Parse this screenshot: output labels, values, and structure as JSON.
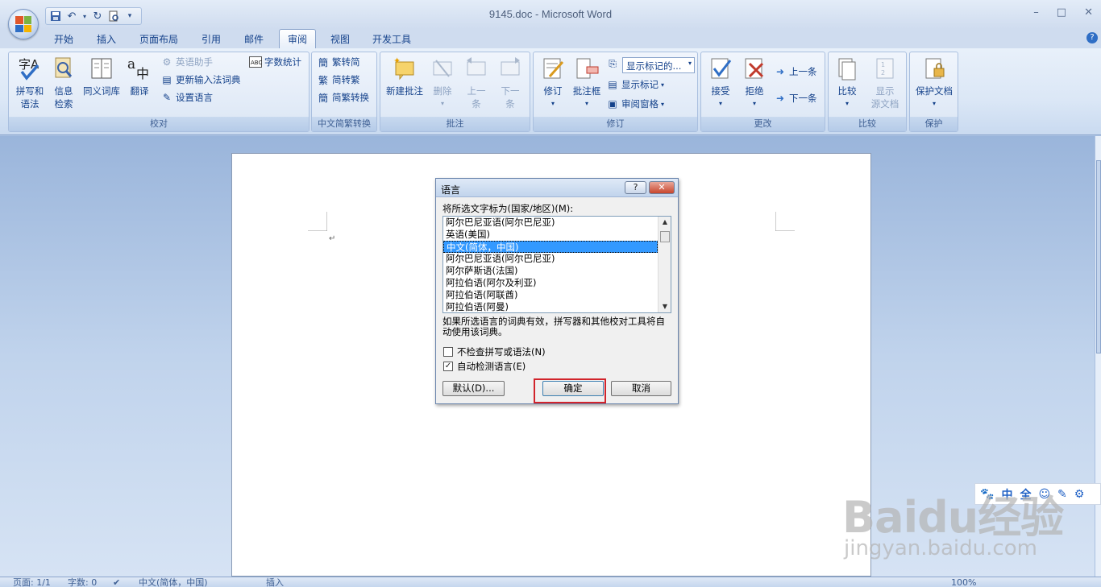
{
  "window": {
    "title": "9145.doc - Microsoft Word",
    "controls": [
      "–",
      "□",
      "✕"
    ]
  },
  "tabs": [
    "开始",
    "插入",
    "页面布局",
    "引用",
    "邮件",
    "审阅",
    "视图",
    "开发工具"
  ],
  "active_tab": "审阅",
  "ribbon": {
    "proofing": {
      "label": "校对",
      "spelling": [
        "拼写和",
        "语法"
      ],
      "research": [
        "信息",
        "检索"
      ],
      "thesaurus": "同义词库",
      "translate": "翻译",
      "english_assistant": "英语助手",
      "word_count": "字数统计",
      "update_ime": "更新输入法词典",
      "set_language": "设置语言"
    },
    "chinese_conversion": {
      "label": "中文简繁转换",
      "trad_to_simp": "繁转简",
      "simp_to_trad": "简转繁",
      "convert": "简繁转换"
    },
    "comments": {
      "label": "批注",
      "new_comment": "新建批注",
      "delete": "删除",
      "previous": [
        "上一",
        "条"
      ],
      "next": [
        "下一",
        "条"
      ]
    },
    "tracking": {
      "label": "修订",
      "track_changes": "修订",
      "balloons": "批注框",
      "display_dropdown": "显示标记的...",
      "show_markup": "显示标记",
      "reviewing_pane": "审阅窗格"
    },
    "changes": {
      "label": "更改",
      "accept": "接受",
      "reject": "拒绝",
      "previous": "上一条",
      "next": "下一条"
    },
    "compare": {
      "label": "比较",
      "compare": "比较",
      "show_source": [
        "显示",
        "源文档"
      ]
    },
    "protect": {
      "label": "保护",
      "protect_doc": "保护文档"
    }
  },
  "dialog": {
    "title": "语言",
    "help": "?",
    "close": "✕",
    "prompt": "将所选文字标为(国家/地区)(M):",
    "languages": [
      "阿尔巴尼亚语(阿尔巴尼亚)",
      "英语(美国)",
      "中文(简体，中国)",
      "阿尔巴尼亚语(阿尔巴尼亚)",
      "阿尔萨斯语(法国)",
      "阿拉伯语(阿尔及利亚)",
      "阿拉伯语(阿联酋)",
      "阿拉伯语(阿曼)"
    ],
    "selected_index": 2,
    "note": "如果所选语言的词典有效，拼写器和其他校对工具将自动使用该词典。",
    "no_check_label": "不检查拼写或语法(N)",
    "no_check_checked": false,
    "auto_detect_label": "自动检测语言(E)",
    "auto_detect_checked": true,
    "default_button": "默认(D)...",
    "ok_button": "确定",
    "cancel_button": "取消"
  },
  "status_bar": {
    "page": "页面: 1/1",
    "words": "字数: 0",
    "language": "中文(简体，中国)",
    "mode": "插入",
    "zoom": "100%"
  },
  "ime_bar": [
    "中",
    "全"
  ],
  "watermark": {
    "brand": "Baidu经验",
    "url": "jingyan.baidu.com"
  },
  "colors": {
    "accent": "#15428b",
    "highlight": "#d1242b",
    "selection": "#3399ff"
  }
}
